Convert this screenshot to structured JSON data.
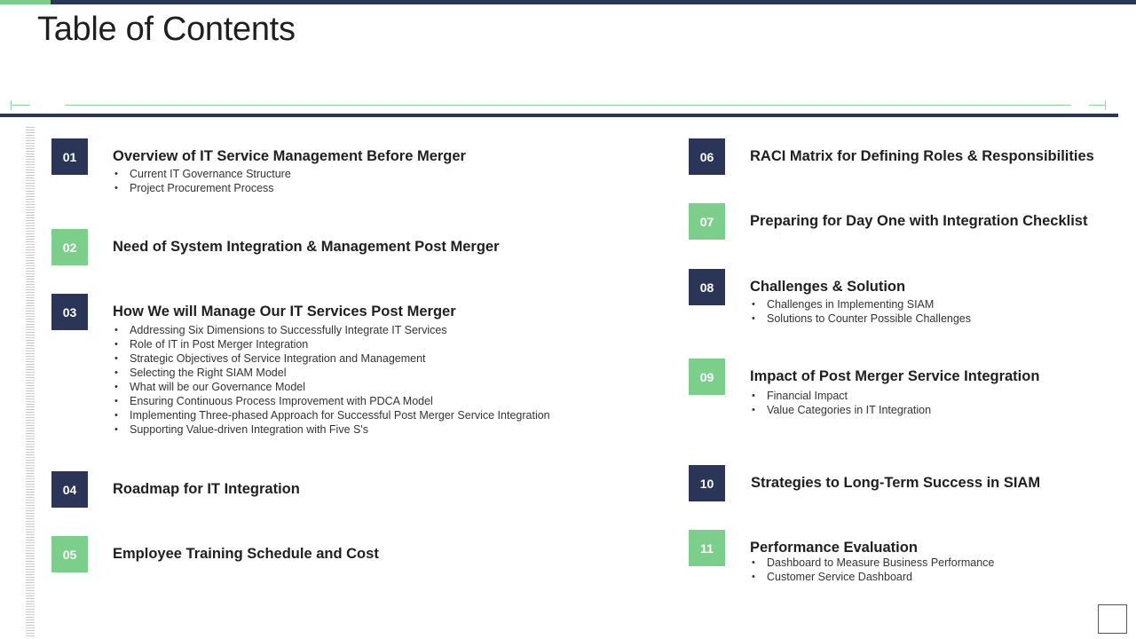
{
  "title": "Table of Contents",
  "colors": {
    "navy": "#2b3557",
    "green": "#7ccf8a"
  },
  "left_items": [
    {
      "num": "01",
      "heading": "Overview of IT Service Management Before Merger",
      "bullets": [
        "Current IT Governance  Structure",
        "Project Procurement Process"
      ]
    },
    {
      "num": "02",
      "heading": "Need of System Integration & Management Post Merger",
      "bullets": []
    },
    {
      "num": "03",
      "heading": "How We will Manage Our IT Services Post Merger",
      "bullets": [
        "Addressing Six Dimensions to Successfully Integrate IT Services",
        "Role of IT in Post Merger Integration",
        "Strategic Objectives of Service Integration and Management",
        "Selecting the Right SIAM Model",
        "What will be our Governance  Model",
        "Ensuring Continuous Process Improvement  with PDCA Model",
        "Implementing Three-phased  Approach for Successful Post Merger Service Integration",
        "Supporting Value-driven  Integration with Five S's"
      ]
    },
    {
      "num": "04",
      "heading": "Roadmap for IT Integration",
      "bullets": []
    },
    {
      "num": "05",
      "heading": "Employee Training Schedule and Cost",
      "bullets": []
    }
  ],
  "right_items": [
    {
      "num": "06",
      "heading": "RACI Matrix for Defining Roles & Responsibilities",
      "bullets": []
    },
    {
      "num": "07",
      "heading": "Preparing for Day One with Integration Checklist",
      "bullets": []
    },
    {
      "num": "08",
      "heading": "Challenges & Solution",
      "bullets": [
        "Challenges in Implementing SIAM",
        "Solutions to Counter Possible Challenges"
      ]
    },
    {
      "num": "09",
      "heading": "Impact of Post Merger Service Integration",
      "bullets": [
        "Financial Impact",
        "Value Categories in IT Integration"
      ]
    },
    {
      "num": "10",
      "heading": "Strategies to Long-Term Success in SIAM",
      "bullets": []
    },
    {
      "num": "11",
      "heading": "Performance Evaluation",
      "bullets": [
        "Dashboard to Measure Business Performance",
        "Customer Service Dashboard"
      ]
    }
  ]
}
